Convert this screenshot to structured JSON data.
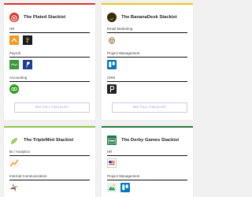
{
  "colors": {
    "background": "#f1f1f1",
    "card_plated_accent": "#d9332b",
    "card_bananadesk_accent": "#f0c419",
    "card_triplemint_accent": "#8cc84b",
    "card_derby_accent": "#1f7a3d",
    "link_button_text": "#8890c6"
  },
  "cards": [
    {
      "title": "The Plated Stackist",
      "logo_icon": "plated-logo-icon",
      "sections": [
        {
          "label": "HR",
          "tools": [
            "orange-arrow-app-icon",
            "black-tree-app-icon"
          ]
        },
        {
          "label": "Payroll",
          "tools": [
            "green-script-app-icon",
            "paypal-icon"
          ]
        },
        {
          "label": "Accounting",
          "tools": [
            "quickbooks-icon"
          ]
        }
      ],
      "button_label": "SEE FULL STACKLIST"
    },
    {
      "title": "The BananaDesk Stackist",
      "logo_icon": "bananadesk-logo-icon",
      "sections": [
        {
          "label": "Email Marketing",
          "tools": [
            "mailchimp-icon"
          ]
        },
        {
          "label": "Project Management",
          "tools": [
            "trello-icon"
          ]
        },
        {
          "label": "CRM",
          "tools": [
            "pipedrive-icon"
          ]
        }
      ],
      "button_label": "SEE FULL STACKLIST"
    },
    {
      "title": "The TripleMint Stackist",
      "logo_icon": "triplemint-leaf-icon",
      "sections": [
        {
          "label": "BI / Analytics",
          "tools": [
            "analytics-chart-icon"
          ]
        },
        {
          "label": "Internal Communication",
          "tools": [
            "slack-icon"
          ]
        }
      ]
    },
    {
      "title": "The Derby Games Stackist",
      "logo_icon": "derby-games-logo-icon",
      "sections": [
        {
          "label": "HR",
          "tools": [
            "flag-app-icon"
          ]
        },
        {
          "label": "Project Management",
          "tools": [
            "mountain-app-icon",
            "trello-icon"
          ]
        }
      ]
    }
  ]
}
